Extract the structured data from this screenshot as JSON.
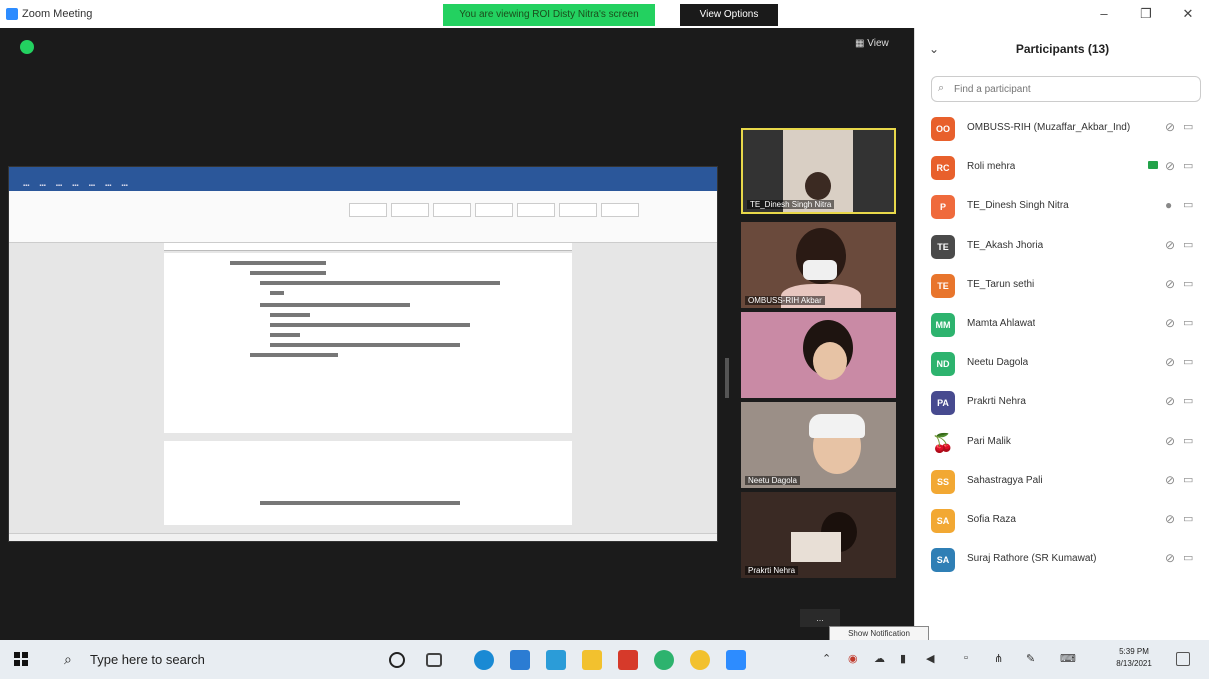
{
  "window": {
    "title": "Zoom Meeting",
    "share_banner": "You are viewing ROI Disty Nitra's screen",
    "view_options": "View Options",
    "view_label": "View"
  },
  "participants_panel": {
    "title": "Participants (13)",
    "search_placeholder": "Find a participant",
    "participants": [
      {
        "initials": "OO",
        "name": "OMBUSS-RIH (Muzaffar_Akbar_Ind)",
        "color": "#e8602c",
        "mic": "muted",
        "video": "off"
      },
      {
        "initials": "RC",
        "name": "Roli mehra",
        "color": "#e8602c",
        "mic": "muted",
        "video": "off",
        "sharing": true
      },
      {
        "initials": "P",
        "name": "TE_Dinesh Singh Nitra",
        "color": "#ef6a3c",
        "mic": "on",
        "video": "off"
      },
      {
        "initials": "TE",
        "name": "TE_Akash Jhoria",
        "color": "#4a4a4a",
        "mic": "muted",
        "video": "off"
      },
      {
        "initials": "TE",
        "name": "TE_Tarun sethi",
        "color": "#e8752c",
        "mic": "muted",
        "video": "off"
      },
      {
        "initials": "MM",
        "name": "Mamta Ahlawat",
        "color": "#2db36e",
        "mic": "muted",
        "video": "off"
      },
      {
        "initials": "ND",
        "name": "Neetu Dagola",
        "color": "#2db36e",
        "mic": "muted",
        "video": "off"
      },
      {
        "initials": "PA",
        "name": "Prakrti Nehra",
        "color": "#474a8f",
        "mic": "muted",
        "video": "off"
      },
      {
        "initials": "",
        "name": "Pari Malik",
        "color": "#c0392b",
        "mic": "muted",
        "video": "off",
        "emoji_avatar": true
      },
      {
        "initials": "SS",
        "name": "Sahastragya Pali",
        "color": "#f2a833",
        "mic": "muted",
        "video": "off"
      },
      {
        "initials": "SA",
        "name": "Sofia Raza",
        "color": "#f2a833",
        "mic": "muted",
        "video": "off"
      },
      {
        "initials": "SA",
        "name": "Suraj Rathore (SR Kumawat)",
        "color": "#2f7fb5",
        "mic": "muted",
        "video": "off"
      }
    ]
  },
  "video_tiles": [
    {
      "name": "TE_Dinesh Singh Nitra",
      "active": true
    },
    {
      "name": "OMBUSS-RIH Akbar",
      "active": false
    },
    {
      "name": "",
      "active": false
    },
    {
      "name": "Neetu Dagola",
      "active": false
    },
    {
      "name": "Prakrti Nehra",
      "active": false
    }
  ],
  "more_label": "...",
  "tooltip": "Show Notification",
  "taskbar": {
    "search_placeholder": "Type here to search",
    "time": "5:39 PM",
    "date": "8/13/2021"
  },
  "icons": {
    "start": "windows-logo-icon",
    "search": "search-icon",
    "task_view": "task-view-icon"
  }
}
